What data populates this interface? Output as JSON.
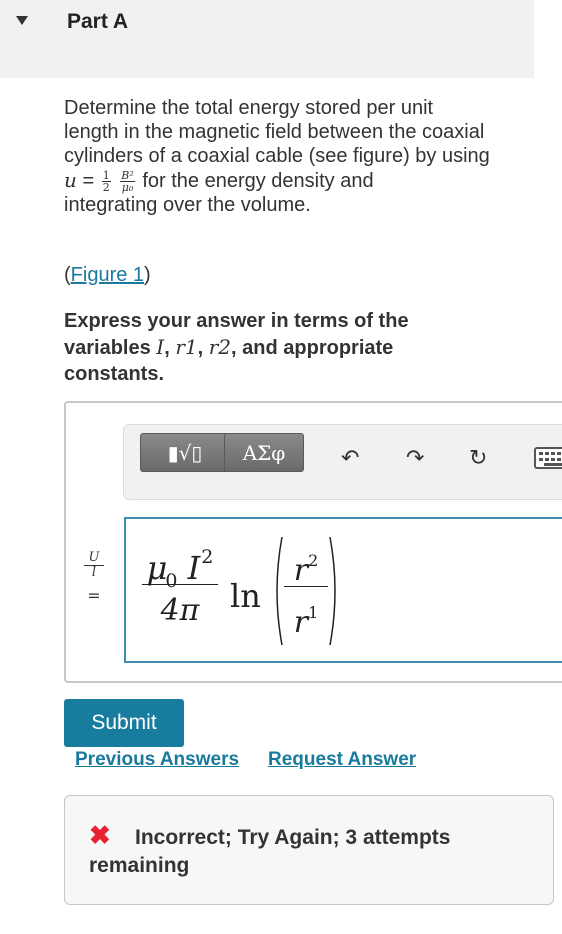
{
  "part": {
    "title": "Part A"
  },
  "problem": {
    "line1": "Determine the total energy stored per unit",
    "line2": "length in the magnetic field between the coaxial",
    "line3": "cylinders of a coaxial cable (see figure) by using",
    "formula_lhs": "u",
    "formula_eq": "=",
    "formula_num_1": "1",
    "formula_den_1": "2",
    "formula_num_2": "B²",
    "formula_den_2": "μ₀",
    "line4_tail": "for the energy density and",
    "line5": "integrating over the volume."
  },
  "figure_link": {
    "open": "(",
    "label": "Figure 1",
    "close": ")"
  },
  "instructions": {
    "prefix": "Express your answer in terms of the",
    "vars_label": "variables",
    "var1": "I",
    "var2": "r1",
    "var3": "r2",
    "suffix": ", and appropriate",
    "line3": "constants."
  },
  "toolbar": {
    "template_label": "▮√▯",
    "greek_label": "ΑΣφ",
    "undo_label": "↶",
    "redo_label": "↷",
    "reset_label": "↻"
  },
  "answer": {
    "lhs_num": "U",
    "lhs_den": "l",
    "lhs_eq": "=",
    "num_mu": "μ",
    "num_sub": "0",
    "num_I": "I",
    "num_sup": "2",
    "den": "4π",
    "ln": "ln",
    "inner_num": "r",
    "inner_num_sup": "2",
    "inner_den": "r",
    "inner_den_sup": "1"
  },
  "actions": {
    "submit": "Submit",
    "previous_answers": "Previous Answers",
    "request_answer": "Request Answer"
  },
  "feedback": {
    "icon": "✖",
    "text": "Incorrect; Try Again; 3 attempts remaining"
  },
  "colors": {
    "accent": "#187c9e",
    "link": "#1a7a9e",
    "error": "#e8222e",
    "editor_border": "#3d8eb0"
  }
}
